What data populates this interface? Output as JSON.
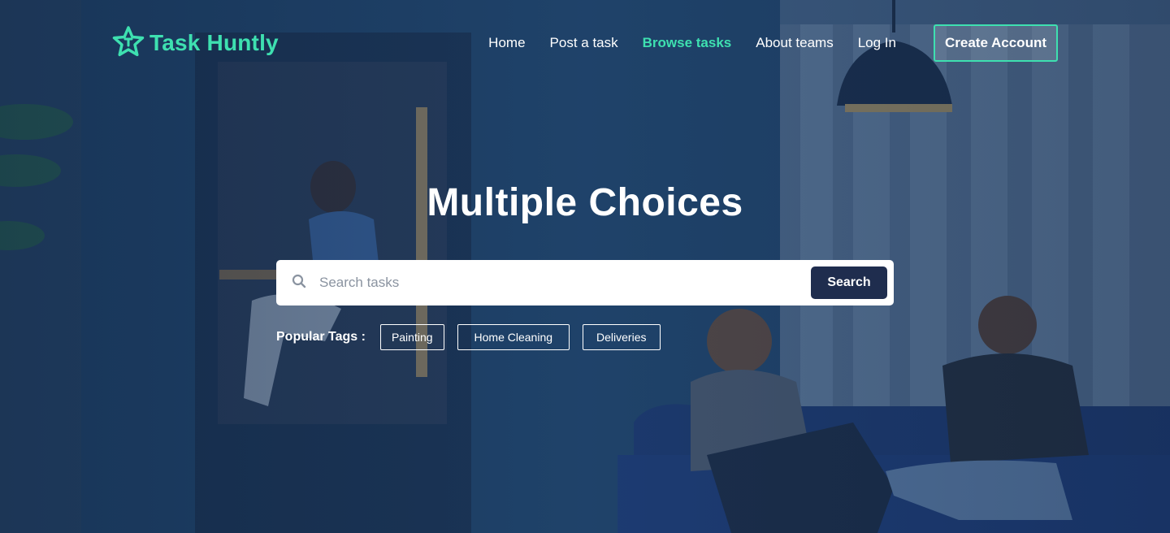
{
  "brand": {
    "name": "Task Huntly",
    "color": "#3ee0b0"
  },
  "nav": {
    "home": "Home",
    "post_task": "Post a task",
    "browse_tasks": "Browse tasks",
    "about_teams": "About teams",
    "log_in": "Log In",
    "active": "browse_tasks",
    "create_account": "Create Account"
  },
  "hero": {
    "title": "Multiple Choices"
  },
  "search": {
    "placeholder": "Search tasks",
    "value": "",
    "button_label": "Search",
    "button_color": "#1f2d4e"
  },
  "tags": {
    "label": "Popular Tags :",
    "items": [
      "Painting",
      "Home Cleaning",
      "Deliveries"
    ]
  },
  "icons": {
    "logo": "star-logo-icon",
    "search": "search-icon"
  }
}
